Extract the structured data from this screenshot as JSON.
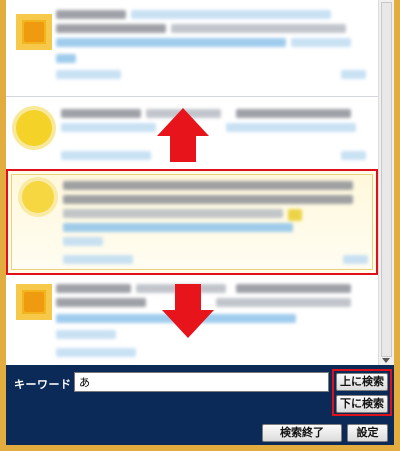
{
  "search_panel": {
    "keyword_label": "キーワード",
    "keyword_value": "あ",
    "search_up_label": "上に検索",
    "search_down_label": "下に検索",
    "end_search_label": "検索終了",
    "settings_label": "設定"
  },
  "timeline": {
    "highlighted_item_index": 2,
    "items": [
      {
        "avatar": "orange-square-avatar",
        "content": "blurred"
      },
      {
        "avatar": "yellow-circle-avatar",
        "content": "blurred"
      },
      {
        "avatar": "yellow-circle-avatar",
        "content": "blurred"
      },
      {
        "avatar": "orange-square-avatar",
        "content": "blurred"
      }
    ]
  },
  "annotations": {
    "up_arrow": "red-up-arrow-icon",
    "down_arrow": "red-down-arrow-icon",
    "highlight_color": "#e0101b"
  },
  "colors": {
    "panel_background": "#0b2a57",
    "frame": "#e3ac3e"
  }
}
